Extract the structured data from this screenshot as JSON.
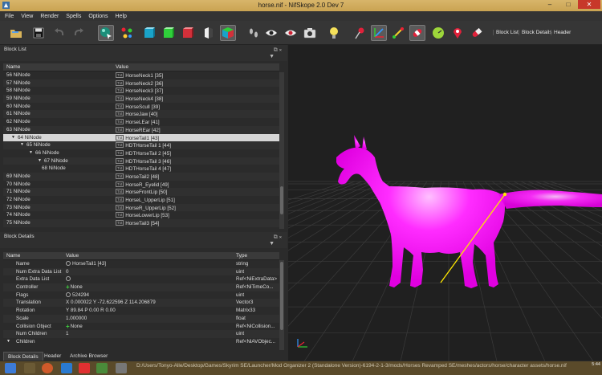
{
  "window": {
    "title": "horse.nif - NifSkope 2.0 Dev 7"
  },
  "menu": [
    "File",
    "View",
    "Render",
    "Spells",
    "Options",
    "Help"
  ],
  "toolbar": {
    "text_buttons": [
      "Block List",
      "Block Details",
      "Header"
    ]
  },
  "block_list": {
    "title": "Block List",
    "columns": [
      "Name",
      "Value"
    ],
    "rows": [
      {
        "name": "56 NiNode",
        "value": "HorseNeck1 [35]",
        "depth": 0,
        "expander": ""
      },
      {
        "name": "57 NiNode",
        "value": "HorseNeck2 [36]",
        "depth": 0,
        "expander": ""
      },
      {
        "name": "58 NiNode",
        "value": "HorseNeck3 [37]",
        "depth": 0,
        "expander": ""
      },
      {
        "name": "59 NiNode",
        "value": "HorseNeck4 [38]",
        "depth": 0,
        "expander": ""
      },
      {
        "name": "60 NiNode",
        "value": "HorseScull [39]",
        "depth": 0,
        "expander": ""
      },
      {
        "name": "61 NiNode",
        "value": "HorseJaw [40]",
        "depth": 0,
        "expander": ""
      },
      {
        "name": "62 NiNode",
        "value": "HorseLEar [41]",
        "depth": 0,
        "expander": ""
      },
      {
        "name": "63 NiNode",
        "value": "HorseREar [42]",
        "depth": 0,
        "expander": ""
      },
      {
        "name": "64 NiNode",
        "value": "HorseTail1 [43]",
        "depth": 0,
        "expander": "▼",
        "selected": true
      },
      {
        "name": "65 NiNode",
        "value": "HDTHorseTail 1 [44]",
        "depth": 1,
        "expander": "▼"
      },
      {
        "name": "66 NiNode",
        "value": "HDTHorseTail 2 [45]",
        "depth": 2,
        "expander": "▼"
      },
      {
        "name": "67 NiNode",
        "value": "HDTHorseTail 3 [46]",
        "depth": 3,
        "expander": "▼"
      },
      {
        "name": "68 NiNode",
        "value": "HDTHorseTail 4 [47]",
        "depth": 4,
        "expander": ""
      },
      {
        "name": "69 NiNode",
        "value": "HorseTail2 [48]",
        "depth": 0,
        "expander": ""
      },
      {
        "name": "70 NiNode",
        "value": "HorseR_Eyelid [49]",
        "depth": 0,
        "expander": ""
      },
      {
        "name": "71 NiNode",
        "value": "HorseFrontLip [50]",
        "depth": 0,
        "expander": ""
      },
      {
        "name": "72 NiNode",
        "value": "HorseL_UpperLip [51]",
        "depth": 0,
        "expander": ""
      },
      {
        "name": "73 NiNode",
        "value": "HorseR_UpperLip [52]",
        "depth": 0,
        "expander": ""
      },
      {
        "name": "74 NiNode",
        "value": "HorseLowerLip [53]",
        "depth": 0,
        "expander": ""
      },
      {
        "name": "75 NiNode",
        "value": "HorseTail3 [54]",
        "depth": 0,
        "expander": ""
      }
    ]
  },
  "block_details": {
    "title": "Block Details",
    "columns": [
      "Name",
      "Value",
      "Type"
    ],
    "rows": [
      {
        "name": "Name",
        "value": "HorseTail1 [43]",
        "type": "string",
        "icon": "link"
      },
      {
        "name": "Num Extra Data List",
        "value": "0",
        "type": "uint",
        "icon": ""
      },
      {
        "name": "Extra Data List",
        "value": "",
        "type": "Ref<NiExtraData>",
        "icon": "link"
      },
      {
        "name": "Controller",
        "value": "None",
        "type": "Ref<NiTimeCo...",
        "icon": "cross"
      },
      {
        "name": "Flags",
        "value": "524294",
        "type": "uint",
        "icon": "link"
      },
      {
        "name": "Translation",
        "value": "X 0.000022 Y -72.622596 Z 114.206879",
        "type": "Vector3",
        "icon": ""
      },
      {
        "name": "Rotation",
        "value": "Y 89.84 P 0.00 R 0.00",
        "type": "Matrix33",
        "icon": ""
      },
      {
        "name": "Scale",
        "value": "1.000000",
        "type": "float",
        "icon": ""
      },
      {
        "name": "Collision Object",
        "value": "None",
        "type": "Ref<NiCollision...",
        "icon": "cross"
      },
      {
        "name": "Num Children",
        "value": "1",
        "type": "uint",
        "icon": ""
      },
      {
        "name": "Children",
        "value": "",
        "type": "Ref<NiAVObjec...",
        "icon": "",
        "expander": "▼"
      }
    ]
  },
  "tabs": [
    "Block Details",
    "Header",
    "Archive Browser"
  ],
  "taskbar": {
    "path": "D:/Users/Tonyo-Alle/Desktop/Games/Skyrim SE/Launcher/Mod Organizer 2 (Standalone Version)-6194-2-1-3/mods/Horses Revamped SE/meshes/actors/horse/character assets/horse.nif",
    "time": "5:44"
  },
  "colors": {
    "model": "#ff10ff",
    "bone_line": "#ffe800",
    "selection": "#d6d6d6",
    "close_button": "#c7382a"
  }
}
